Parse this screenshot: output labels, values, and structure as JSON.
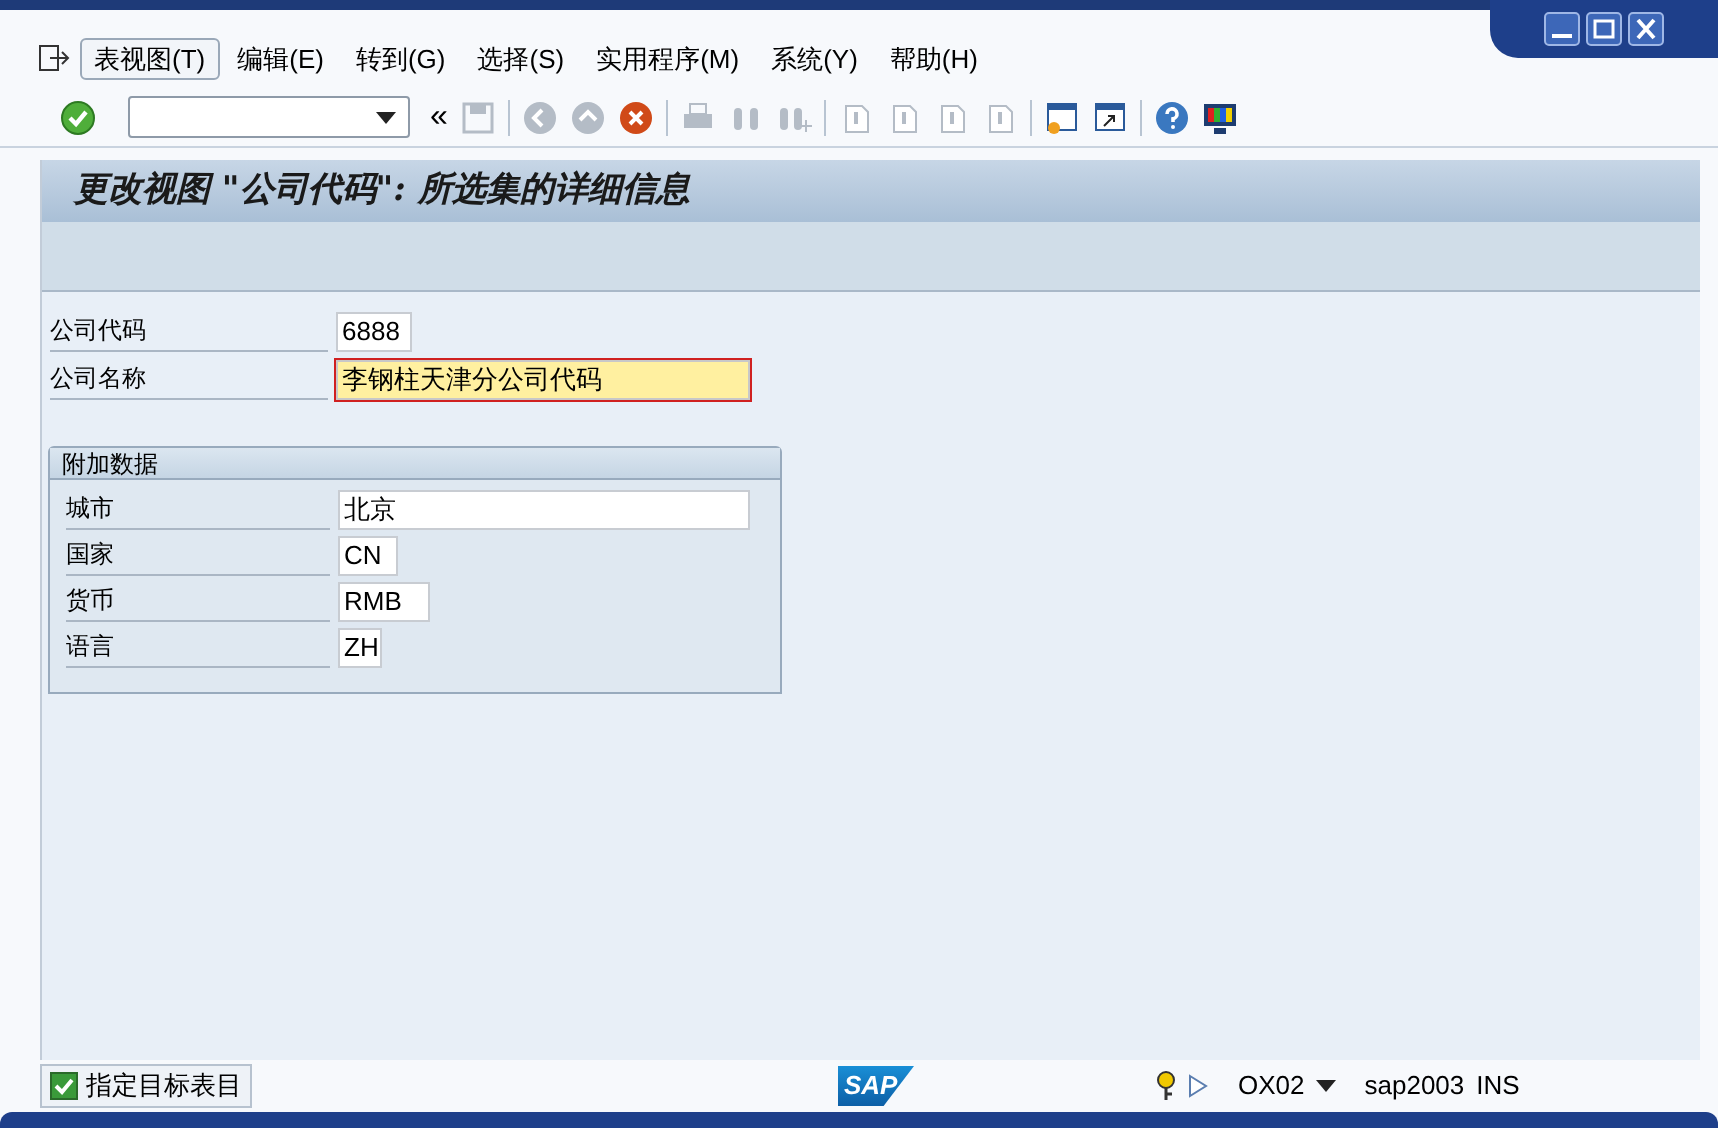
{
  "menu": [
    {
      "label": "表视图(T)",
      "selected": true
    },
    {
      "label": "编辑(E)",
      "selected": false
    },
    {
      "label": "转到(G)",
      "selected": false
    },
    {
      "label": "选择(S)",
      "selected": false
    },
    {
      "label": "实用程序(M)",
      "selected": false
    },
    {
      "label": "系统(Y)",
      "selected": false
    },
    {
      "label": "帮助(H)",
      "selected": false
    }
  ],
  "toolbar": {
    "back_symbol": "«"
  },
  "screen_title": "更改视图 \"公司代码\": 所选集的详细信息",
  "fields": [
    {
      "label": "公司代码",
      "value": "6888",
      "focused": false
    },
    {
      "label": "公司名称",
      "value": "李钢柱天津分公司代码",
      "focused": true
    }
  ],
  "group": {
    "title": "附加数据",
    "fields": [
      {
        "label": "城市",
        "value": "北京"
      },
      {
        "label": "国家",
        "value": "CN"
      },
      {
        "label": "货币",
        "value": "RMB"
      },
      {
        "label": "语言",
        "value": "ZH"
      }
    ]
  },
  "status_bar": {
    "button": "指定目标表目",
    "logo": "SAP",
    "transaction": "OX02",
    "system": "sap2003",
    "mode": "INS"
  }
}
